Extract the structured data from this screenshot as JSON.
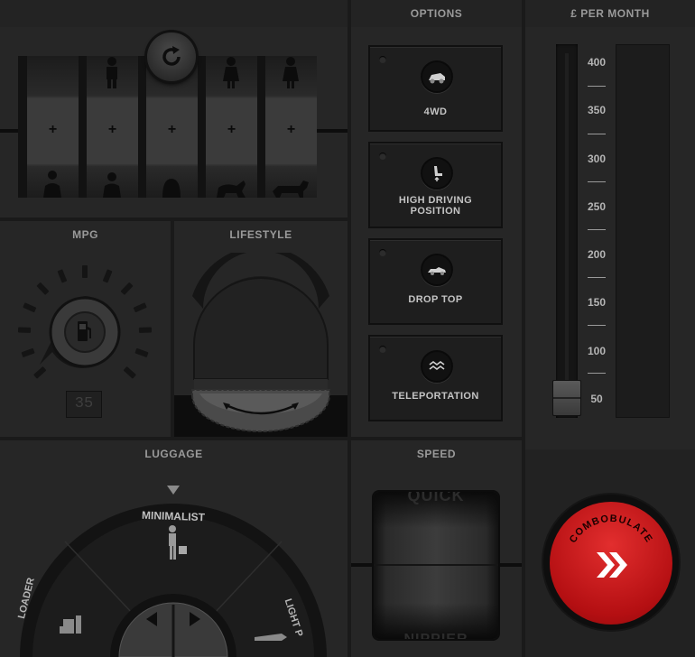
{
  "passengers": {
    "slots": [
      {
        "top_icon": "",
        "plus": "+",
        "bottom_icon": "adult-seated-icon"
      },
      {
        "top_icon": "man-icon",
        "plus": "+",
        "bottom_icon": "adult-seated-icon"
      },
      {
        "top_icon": "",
        "plus": "+",
        "bottom_icon": "child-seated-icon"
      },
      {
        "top_icon": "woman-icon",
        "plus": "+",
        "bottom_icon": "large-dog-icon"
      },
      {
        "top_icon": "woman-icon",
        "plus": "+",
        "bottom_icon": "small-dog-icon"
      }
    ],
    "reset_icon": "refresh-icon"
  },
  "mpg": {
    "title": "MPG",
    "value": "35",
    "icon": "fuel-pump-icon"
  },
  "lifestyle": {
    "title": "LIFESTYLE",
    "icon": "rotate-arrows-icon"
  },
  "options": {
    "title": "OPTIONS",
    "items": [
      {
        "label": "4WD",
        "icon": "offroad-car-icon"
      },
      {
        "label": "HIGH DRIVING",
        "label2": "POSITION",
        "icon": "raised-seat-icon"
      },
      {
        "label": "DROP TOP",
        "icon": "convertible-icon"
      },
      {
        "label": "TELEPORTATION",
        "icon": "teleport-wave-icon"
      }
    ]
  },
  "price": {
    "title": "£ PER MONTH",
    "scale": [
      "400",
      "350",
      "300",
      "250",
      "200",
      "150",
      "100",
      "50"
    ],
    "value": 50
  },
  "luggage": {
    "title": "LUGGAGE",
    "selected": "MINIMALIST",
    "left_label": "LOADER",
    "right_label": "LIGHT P",
    "prev_icon": "triangle-left-icon",
    "next_icon": "triangle-right-icon"
  },
  "speed": {
    "title": "SPEED",
    "top_label": "QUICK",
    "bottom_label": "NIPPIER"
  },
  "combobulate": {
    "label": "COMBOBULATE",
    "icon": "double-chevron-right-icon",
    "accent": "#c8171b"
  }
}
